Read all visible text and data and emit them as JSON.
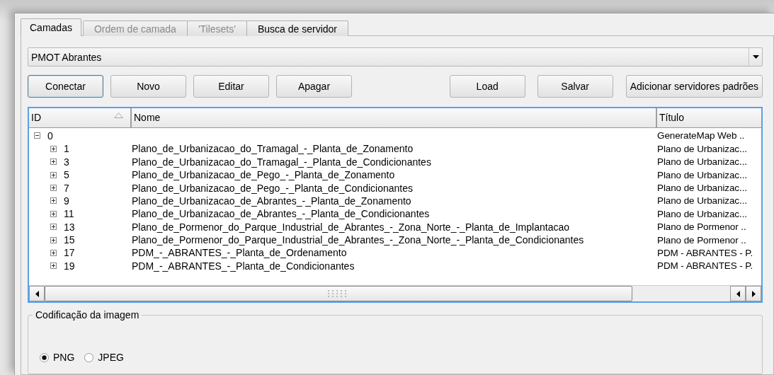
{
  "tabs": [
    {
      "label": "Camadas",
      "selected": true,
      "disabled": false
    },
    {
      "label": "Ordem de camada",
      "selected": false,
      "disabled": true
    },
    {
      "label": "'Tilesets'",
      "selected": false,
      "disabled": true
    },
    {
      "label": "Busca de servidor",
      "selected": false,
      "disabled": false
    }
  ],
  "connection": {
    "value": "PMOT Abrantes"
  },
  "buttons_left": [
    {
      "label": "Conectar",
      "focused": true
    },
    {
      "label": "Novo",
      "focused": false
    },
    {
      "label": "Editar",
      "focused": false
    },
    {
      "label": "Apagar",
      "focused": false
    }
  ],
  "buttons_right": [
    {
      "label": "Load",
      "focused": false
    },
    {
      "label": "Salvar",
      "focused": false
    },
    {
      "label": "Adicionar servidores padrões",
      "focused": false
    }
  ],
  "layers": {
    "columns": [
      "ID",
      "Nome",
      "Título"
    ],
    "rows": [
      {
        "id": "0",
        "name": "",
        "title": "GenerateMap Web ..",
        "expanded": true,
        "children": [
          {
            "id": "1",
            "name": "Plano_de_Urbanizacao_do_Tramagal_-_Planta_de_Zonamento",
            "title": "Plano de Urbanizac...",
            "expanded": false
          },
          {
            "id": "3",
            "name": "Plano_de_Urbanizacao_do_Tramagal_-_Planta_de_Condicionantes",
            "title": "Plano de Urbanizac...",
            "expanded": false
          },
          {
            "id": "5",
            "name": "Plano_de_Urbanizacao_de_Pego_-_Planta_de_Zonamento",
            "title": "Plano de Urbanizac...",
            "expanded": false
          },
          {
            "id": "7",
            "name": "Plano_de_Urbanizacao_de_Pego_-_Planta_de_Condicionantes",
            "title": "Plano de Urbanizac...",
            "expanded": false
          },
          {
            "id": "9",
            "name": "Plano_de_Urbanizacao_de_Abrantes_-_Planta_de_Zonamento",
            "title": "Plano de Urbanizac...",
            "expanded": false
          },
          {
            "id": "11",
            "name": "Plano_de_Urbanizacao_de_Abrantes_-_Planta_de_Condicionantes",
            "title": "Plano de Urbanizac...",
            "expanded": false
          },
          {
            "id": "13",
            "name": "Plano_de_Pormenor_do_Parque_Industrial_de_Abrantes_-_Zona_Norte_-_Planta_de_Implantacao",
            "title": "Plano de Pormenor ..",
            "expanded": false
          },
          {
            "id": "15",
            "name": "Plano_de_Pormenor_do_Parque_Industrial_de_Abrantes_-_Zona_Norte_-_Planta_de_Condicionantes",
            "title": "Plano de Pormenor ..",
            "expanded": false
          },
          {
            "id": "17",
            "name": "PDM_-_ABRANTES_-_Planta_de_Ordenamento",
            "title": "PDM - ABRANTES - P.",
            "expanded": false
          },
          {
            "id": "19",
            "name": "PDM_-_ABRANTES_-_Planta_de_Condicionantes",
            "title": "PDM - ABRANTES - P.",
            "expanded": false
          }
        ]
      }
    ]
  },
  "image_encoding": {
    "title": "Codificação da imagem",
    "options": [
      {
        "label": "PNG",
        "selected": true
      },
      {
        "label": "JPEG",
        "selected": false
      }
    ]
  }
}
